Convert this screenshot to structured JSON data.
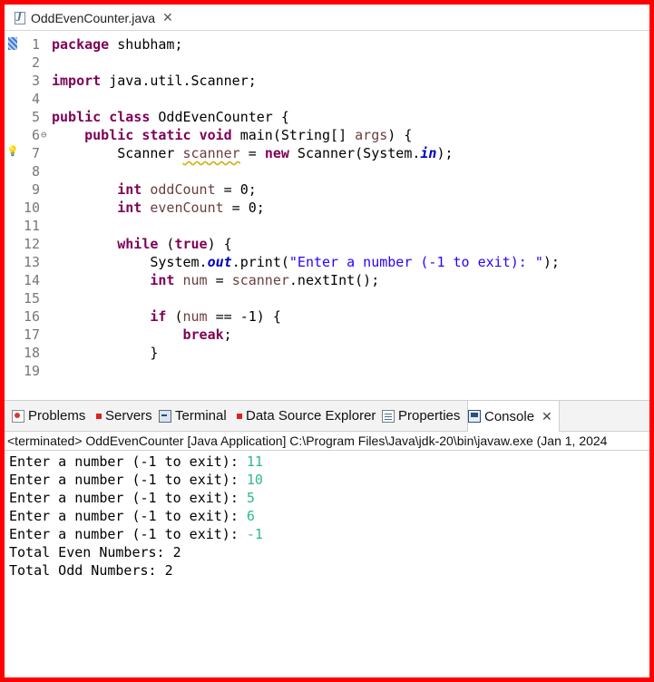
{
  "editor": {
    "tab_label": "OddEvenCounter.java",
    "tab_icon": "java-file-icon",
    "lines": [
      {
        "n": "1",
        "fold": "",
        "tokens": [
          {
            "t": "package",
            "c": "kw"
          },
          {
            "t": " shubham;",
            "c": ""
          }
        ]
      },
      {
        "n": "2",
        "fold": "",
        "tokens": []
      },
      {
        "n": "3",
        "fold": "",
        "tokens": [
          {
            "t": "import",
            "c": "kw"
          },
          {
            "t": " java.util.Scanner;",
            "c": ""
          }
        ]
      },
      {
        "n": "4",
        "fold": "",
        "tokens": []
      },
      {
        "n": "5",
        "fold": "",
        "tokens": [
          {
            "t": "public",
            "c": "kw"
          },
          {
            "t": " ",
            "c": ""
          },
          {
            "t": "class",
            "c": "kw"
          },
          {
            "t": " OddEvenCounter {",
            "c": ""
          }
        ]
      },
      {
        "n": "6",
        "fold": "⊖",
        "tokens": [
          {
            "t": "    ",
            "c": ""
          },
          {
            "t": "public",
            "c": "kw"
          },
          {
            "t": " ",
            "c": ""
          },
          {
            "t": "static",
            "c": "kw"
          },
          {
            "t": " ",
            "c": ""
          },
          {
            "t": "void",
            "c": "kw"
          },
          {
            "t": " main(String[] ",
            "c": ""
          },
          {
            "t": "args",
            "c": "var"
          },
          {
            "t": ") {",
            "c": ""
          }
        ]
      },
      {
        "n": "7",
        "fold": "",
        "tokens": [
          {
            "t": "        Scanner ",
            "c": ""
          },
          {
            "t": "scanner",
            "c": "var warnline"
          },
          {
            "t": " = ",
            "c": ""
          },
          {
            "t": "new",
            "c": "kw"
          },
          {
            "t": " Scanner(System.",
            "c": ""
          },
          {
            "t": "in",
            "c": "fld"
          },
          {
            "t": ");",
            "c": ""
          }
        ]
      },
      {
        "n": "8",
        "fold": "",
        "tokens": []
      },
      {
        "n": "9",
        "fold": "",
        "tokens": [
          {
            "t": "        ",
            "c": ""
          },
          {
            "t": "int",
            "c": "kw"
          },
          {
            "t": " ",
            "c": ""
          },
          {
            "t": "oddCount",
            "c": "var"
          },
          {
            "t": " = 0;",
            "c": ""
          }
        ]
      },
      {
        "n": "10",
        "fold": "",
        "tokens": [
          {
            "t": "        ",
            "c": ""
          },
          {
            "t": "int",
            "c": "kw"
          },
          {
            "t": " ",
            "c": ""
          },
          {
            "t": "evenCount",
            "c": "var"
          },
          {
            "t": " = 0;",
            "c": ""
          }
        ]
      },
      {
        "n": "11",
        "fold": "",
        "tokens": []
      },
      {
        "n": "12",
        "fold": "",
        "tokens": [
          {
            "t": "        ",
            "c": ""
          },
          {
            "t": "while",
            "c": "kw"
          },
          {
            "t": " (",
            "c": ""
          },
          {
            "t": "true",
            "c": "kw"
          },
          {
            "t": ") {",
            "c": ""
          }
        ]
      },
      {
        "n": "13",
        "fold": "",
        "tokens": [
          {
            "t": "            System.",
            "c": ""
          },
          {
            "t": "out",
            "c": "fld"
          },
          {
            "t": ".print(",
            "c": ""
          },
          {
            "t": "\"Enter a number (-1 to exit): \"",
            "c": "str"
          },
          {
            "t": ");",
            "c": ""
          }
        ]
      },
      {
        "n": "14",
        "fold": "",
        "tokens": [
          {
            "t": "            ",
            "c": ""
          },
          {
            "t": "int",
            "c": "kw"
          },
          {
            "t": " ",
            "c": ""
          },
          {
            "t": "num",
            "c": "var"
          },
          {
            "t": " = ",
            "c": ""
          },
          {
            "t": "scanner",
            "c": "var"
          },
          {
            "t": ".nextInt();",
            "c": ""
          }
        ]
      },
      {
        "n": "15",
        "fold": "",
        "tokens": []
      },
      {
        "n": "16",
        "fold": "",
        "tokens": [
          {
            "t": "            ",
            "c": ""
          },
          {
            "t": "if",
            "c": "kw"
          },
          {
            "t": " (",
            "c": ""
          },
          {
            "t": "num",
            "c": "var"
          },
          {
            "t": " == -1) {",
            "c": ""
          }
        ]
      },
      {
        "n": "17",
        "fold": "",
        "tokens": [
          {
            "t": "                ",
            "c": ""
          },
          {
            "t": "break",
            "c": "kw"
          },
          {
            "t": ";",
            "c": ""
          }
        ]
      },
      {
        "n": "18",
        "fold": "",
        "tokens": [
          {
            "t": "            }",
            "c": ""
          }
        ]
      },
      {
        "n": "19",
        "fold": "",
        "tokens": []
      }
    ]
  },
  "views": {
    "tabs": [
      {
        "label": "Problems",
        "icon": "problems-icon"
      },
      {
        "label": "Servers",
        "icon": "servers-icon"
      },
      {
        "label": "Terminal",
        "icon": "terminal-icon"
      },
      {
        "label": "Data Source Explorer",
        "icon": "datasource-icon"
      },
      {
        "label": "Properties",
        "icon": "properties-icon"
      },
      {
        "label": "Console",
        "icon": "console-icon",
        "active": true
      }
    ]
  },
  "console": {
    "status": "<terminated> OddEvenCounter [Java Application] C:\\Program Files\\Java\\jdk-20\\bin\\javaw.exe  (Jan 1, 2024",
    "lines": [
      {
        "prompt": "Enter a number (-1 to exit): ",
        "input": "11"
      },
      {
        "prompt": "Enter a number (-1 to exit): ",
        "input": "10"
      },
      {
        "prompt": "Enter a number (-1 to exit): ",
        "input": "5"
      },
      {
        "prompt": "Enter a number (-1 to exit): ",
        "input": "6"
      },
      {
        "prompt": "Enter a number (-1 to exit): ",
        "input": "-1"
      },
      {
        "prompt": "Total Even Numbers: 2",
        "input": ""
      },
      {
        "prompt": "Total Odd Numbers: 2",
        "input": ""
      }
    ]
  },
  "colors": {
    "frame_border": "#ff0000",
    "keyword": "#7f0055",
    "string": "#2a00ff",
    "local_variable": "#6a3e3e",
    "static_field": "#0000c0",
    "console_input": "#2eb88f"
  }
}
